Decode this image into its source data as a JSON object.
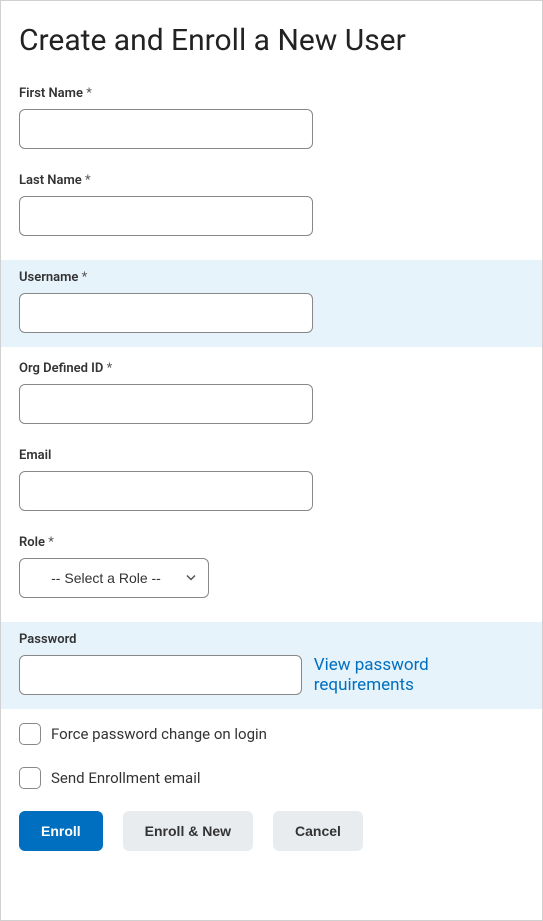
{
  "title": "Create and Enroll a New User",
  "fields": {
    "first_name": {
      "label": "First Name",
      "required": "*",
      "value": ""
    },
    "last_name": {
      "label": "Last Name",
      "required": "*",
      "value": ""
    },
    "username": {
      "label": "Username",
      "required": "*",
      "value": ""
    },
    "org_defined_id": {
      "label": "Org Defined ID",
      "required": "*",
      "value": ""
    },
    "email": {
      "label": "Email",
      "required": "",
      "value": ""
    },
    "role": {
      "label": "Role",
      "required": "*",
      "selected": "-- Select a Role --"
    },
    "password": {
      "label": "Password",
      "required": "",
      "value": ""
    }
  },
  "links": {
    "password_requirements": "View password requirements"
  },
  "checkboxes": {
    "force_password_change": {
      "label": "Force password change on login",
      "checked": false
    },
    "send_enrollment_email": {
      "label": "Send Enrollment email",
      "checked": false
    }
  },
  "buttons": {
    "enroll": "Enroll",
    "enroll_and_new": "Enroll & New",
    "cancel": "Cancel"
  }
}
